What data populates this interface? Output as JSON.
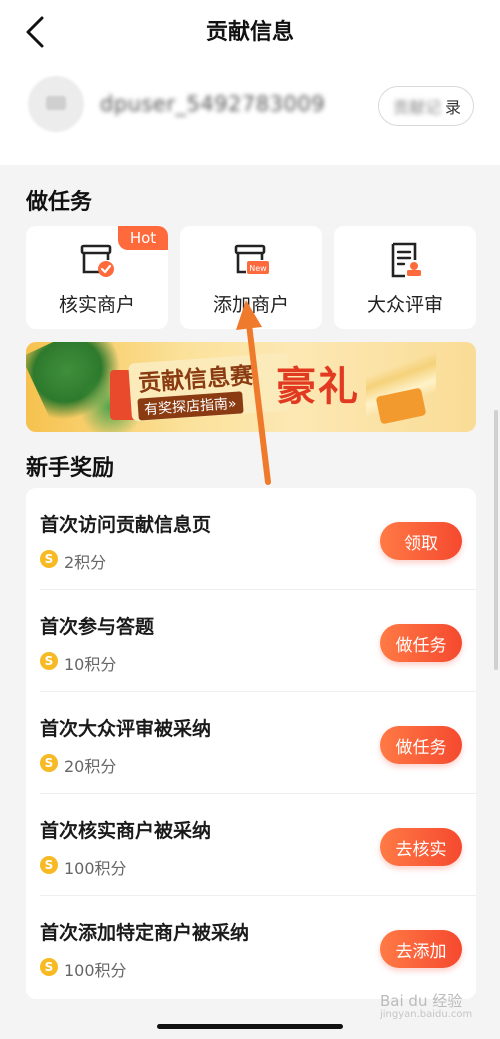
{
  "header": {
    "title": "贡献信息"
  },
  "profile": {
    "username": "dpuser_5492783009",
    "record_button_blurred": "贡献记",
    "record_button_visible": "录"
  },
  "tasks_section": {
    "title": "做任务",
    "cards": [
      {
        "label": "核实商户",
        "badge": "Hot",
        "icon": "shop-check-icon"
      },
      {
        "label": "添加商户",
        "badge": "New",
        "icon": "shop-new-icon"
      },
      {
        "label": "大众评审",
        "icon": "review-document-icon"
      }
    ]
  },
  "banner": {
    "main_text": "贡献信息赛",
    "sub_text": "有奖探店指南»",
    "big_text": "豪礼"
  },
  "rewards_section": {
    "title": "新手奖励",
    "items": [
      {
        "title": "首次访问贡献信息页",
        "points": "2积分",
        "button": "领取"
      },
      {
        "title": "首次参与答题",
        "points": "10积分",
        "button": "做任务"
      },
      {
        "title": "首次大众评审被采纳",
        "points": "20积分",
        "button": "做任务"
      },
      {
        "title": "首次核实商户被采纳",
        "points": "100积分",
        "button": "去核实"
      },
      {
        "title": "首次添加特定商户被采纳",
        "points": "100积分",
        "button": "去添加"
      }
    ]
  },
  "coin_symbol": "S",
  "watermark": {
    "text": "Bai du 经验",
    "sub": "jingyan.baidu.com"
  },
  "colors": {
    "accent": "#f5492f",
    "accent_light": "#ff7a45",
    "coin": "#f7b924",
    "annotation_arrow": "#f07a2c"
  }
}
